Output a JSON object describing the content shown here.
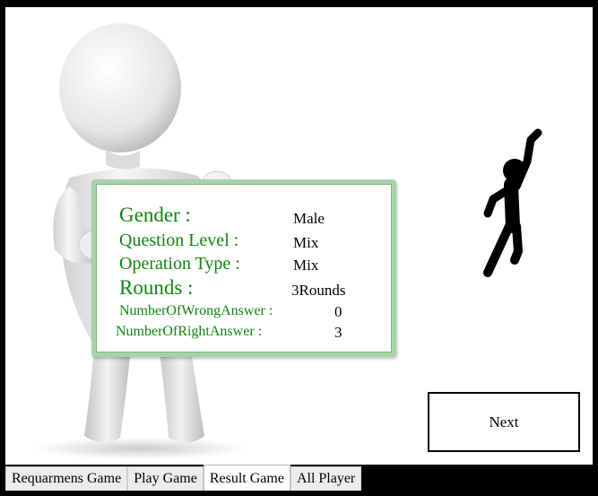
{
  "result": {
    "gender_label": "Gender :",
    "gender_value": "Male",
    "level_label": "Question Level :",
    "level_value": "Mix",
    "operation_label": "Operation Type :",
    "operation_value": "Mix",
    "rounds_label": "Rounds :",
    "rounds_value": "3Rounds",
    "wrong_label": "NumberOfWrongAnswer :",
    "wrong_value": "0",
    "right_label": "NumberOfRightAnswer :",
    "right_value": "3"
  },
  "next_label": "Next",
  "tabs": [
    {
      "label": "Requarmens Game"
    },
    {
      "label": "Play Game"
    },
    {
      "label": "Result Game",
      "active": true
    },
    {
      "label": "All Player"
    }
  ],
  "colors": {
    "label_green": "#118511",
    "board_border": "#a8d3a8"
  },
  "icons": {
    "figure": "3d-person-holding-board",
    "celebration": "cheering-person-icon"
  }
}
